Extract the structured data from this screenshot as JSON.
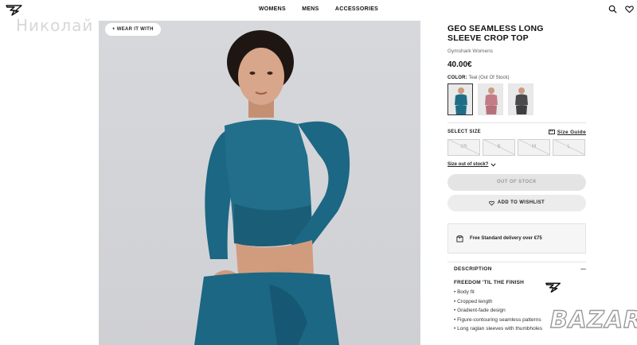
{
  "header": {
    "nav": [
      "WOMENS",
      "MENS",
      "ACCESSORIES"
    ],
    "watermark_text": "Николай"
  },
  "hero": {
    "wear_it_with": "WEAR IT WITH"
  },
  "product": {
    "title_line1": "GEO SEAMLESS LONG",
    "title_line2": "SLEEVE CROP TOP",
    "brand": "Gymshark Womens",
    "price": "40.00€",
    "color_label": "COLOR:",
    "color_value": "Teal (Out Of Stock)",
    "swatches": [
      {
        "name": "Teal",
        "color": "#1f6e86"
      },
      {
        "name": "Pink",
        "color": "#c37b86"
      },
      {
        "name": "Charcoal",
        "color": "#4a4a4d"
      }
    ],
    "select_size": "SELECT SIZE",
    "size_guide": "Size Guide",
    "sizes": [
      "XS",
      "S",
      "M",
      "L"
    ],
    "size_out_of_stock": "Size out of stock?",
    "out_of_stock_button": "OUT OF STOCK",
    "wishlist_button": "ADD TO WISHLIST",
    "delivery_text": "Free Standard delivery over €75",
    "description_title": "DESCRIPTION",
    "description_toggle": "—",
    "description_subtitle": "FREEDOM 'TIL THE FINISH",
    "description_items": [
      "• Body fit",
      "• Cropped length",
      "• Gradient-fade design",
      "• Figure-contouring seamless patterns",
      "• Long raglan sleeves with thumbholes"
    ]
  },
  "watermark": {
    "bazar": "BAZAR"
  },
  "colors": {
    "teal": "#1f6e86",
    "background_photo": "#d4d5d9",
    "button_disabled": "#e4e4e4"
  }
}
